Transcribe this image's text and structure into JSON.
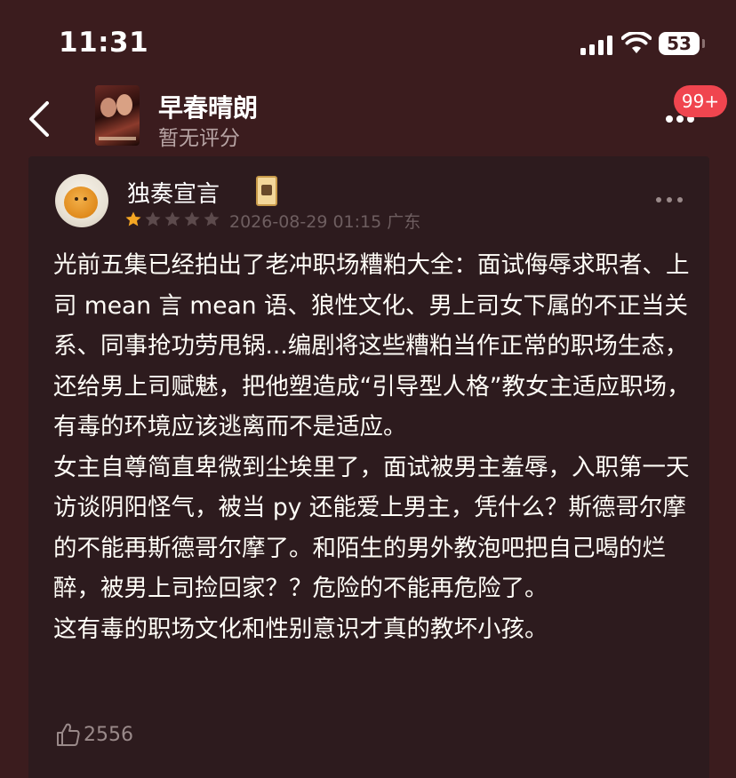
{
  "status_bar": {
    "time": "11:31",
    "battery": "53"
  },
  "header": {
    "back_icon": "chevron-left-icon",
    "title": "早春晴朗",
    "rating": "暂无评分",
    "more_icon": "ellipsis-icon",
    "notification_badge": "99+"
  },
  "review": {
    "username": "独奏宣言",
    "stars": {
      "rating": 1,
      "max": 5,
      "filled_color": "#f5a623",
      "empty_color": "#5c4a4c"
    },
    "meta": "2026-08-29 01:15 广东",
    "paragraphs": [
      "光前五集已经拍出了老冲职场糟粕大全：面试侮辱求职者、上司 mean 言 mean 语、狼性文化、男上司女下属的不正当关系、同事抢功劳甩锅...编剧将这些糟粕当作正常的职场生态，还给男上司赋魅，把他塑造成“引导型人格”教女主适应职场，有毒的环境应该逃离而不是适应。",
      "女主自尊简直卑微到尘埃里了，面试被男主羞辱，入职第一天访谈阴阳怪气，被当 py 还能爱上男主，凭什么？斯德哥尔摩的不能再斯德哥尔摩了。和陌生的男外教泡吧把自己喝的烂醉，被男上司捡回家？？危险的不能再危险了。",
      "这有毒的职场文化和性别意识才真的教坏小孩。"
    ],
    "like_icon": "thumbs-up-icon",
    "like_count": "2556"
  },
  "colors": {
    "background": "#3b1c1e",
    "card": "#2d1b1e",
    "badge": "#f0454f",
    "text": "#fffdf7",
    "muted": "#6e5e60"
  }
}
